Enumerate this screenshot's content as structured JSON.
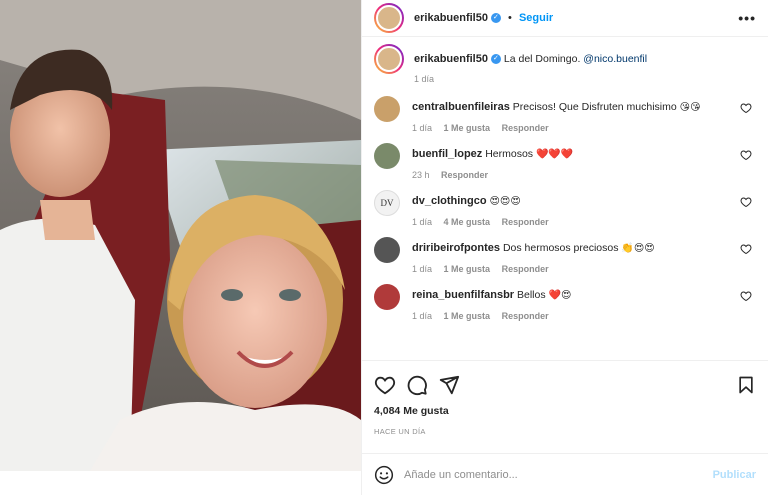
{
  "header": {
    "username": "erikabuenfil50",
    "verified_mark": "✓",
    "separator": "•",
    "follow_label": "Seguir",
    "more_label": "•••"
  },
  "caption": {
    "username": "erikabuenfil50",
    "text": "La del Domingo.",
    "mention": "@nico.buenfil",
    "time": "1 día"
  },
  "comments": [
    {
      "username": "centralbuenfileiras",
      "text": "Precisos! Que Disfruten muchisimo",
      "emoji": "😘😘",
      "time": "1 día",
      "likes": "1 Me gusta",
      "reply": "Responder",
      "avatar_color": "#c9a06a"
    },
    {
      "username": "buenfil_lopez",
      "text": "Hermosos",
      "emoji": "❤️❤️❤️",
      "time": "23 h",
      "likes": "",
      "reply": "Responder",
      "avatar_color": "#7a8a6a"
    },
    {
      "username": "dv_clothingco",
      "text": "",
      "emoji": "😍😍😍",
      "time": "1 día",
      "likes": "4 Me gusta",
      "reply": "Responder",
      "avatar_color": "#f2f2f2",
      "avatar_text": "DV"
    },
    {
      "username": "driribeirofpontes",
      "text": "Dos hermosos preciosos",
      "emoji": "👏😍😍",
      "time": "1 día",
      "likes": "1 Me gusta",
      "reply": "Responder",
      "avatar_color": "#555555"
    },
    {
      "username": "reina_buenfilfansbr",
      "text": "Bellos",
      "emoji": "❤️😍",
      "time": "1 día",
      "likes": "1 Me gusta",
      "reply": "Responder",
      "avatar_color": "#b03a3a"
    }
  ],
  "icons": [
    "heart-icon",
    "comment-icon",
    "share-icon",
    "bookmark-icon"
  ],
  "likes_count": "4,084 Me gusta",
  "posted": "HACE UN DÍA",
  "add_comment": {
    "placeholder": "Añade un comentario...",
    "publish_label": "Publicar"
  },
  "colors": {
    "accent": "#0095f6",
    "publish_disabled": "#b2dffc",
    "muted": "#8e8e8e"
  }
}
